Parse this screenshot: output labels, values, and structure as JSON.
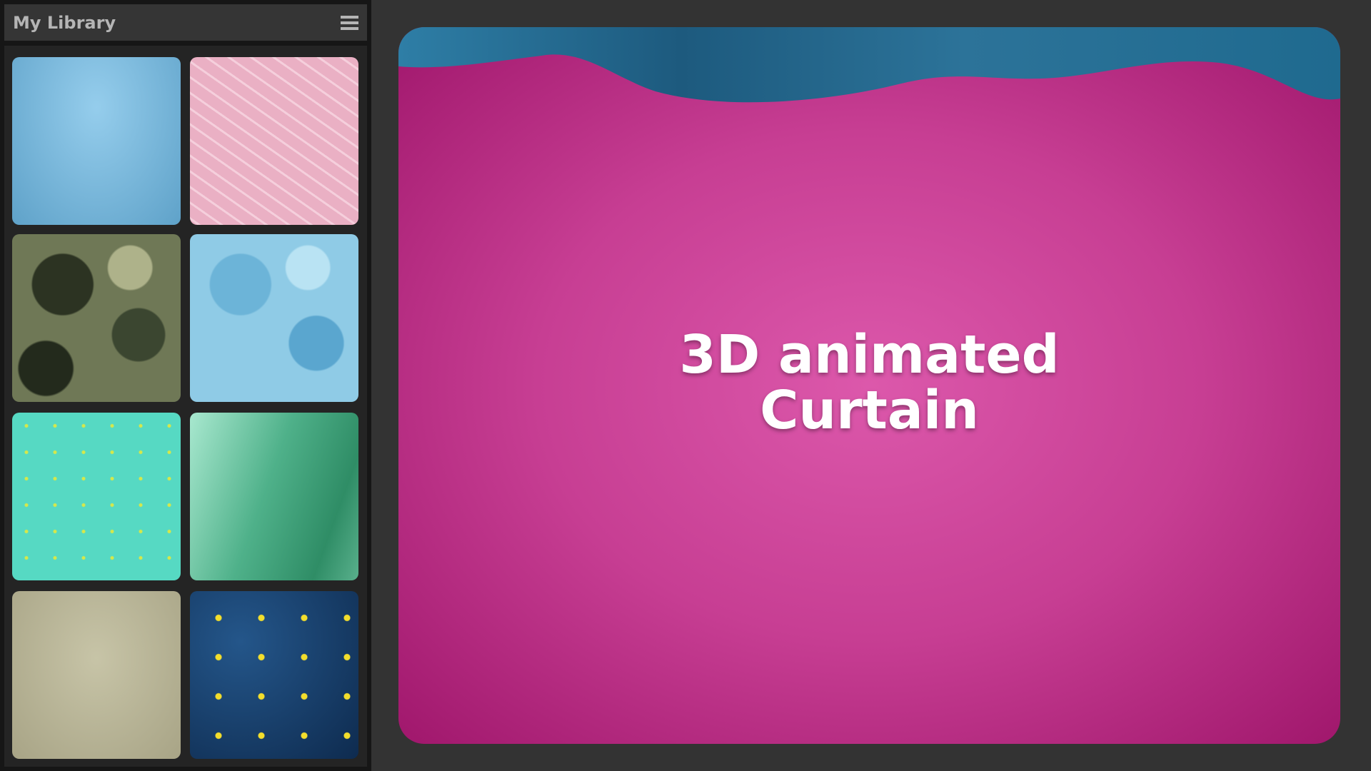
{
  "sidebar": {
    "title": "My Library",
    "menu_icon": "hamburger-icon",
    "items": [
      {
        "name": "blue-gradient"
      },
      {
        "name": "pink-squiggle"
      },
      {
        "name": "green-camo"
      },
      {
        "name": "blue-camo"
      },
      {
        "name": "turquoise-confetti"
      },
      {
        "name": "green-silk"
      },
      {
        "name": "beige-linen"
      },
      {
        "name": "navy-stars"
      }
    ]
  },
  "preview": {
    "line1": "3D animated",
    "line2": "Curtain",
    "background_color": "#d04a9e",
    "curtain_color": "#2a6f95"
  }
}
